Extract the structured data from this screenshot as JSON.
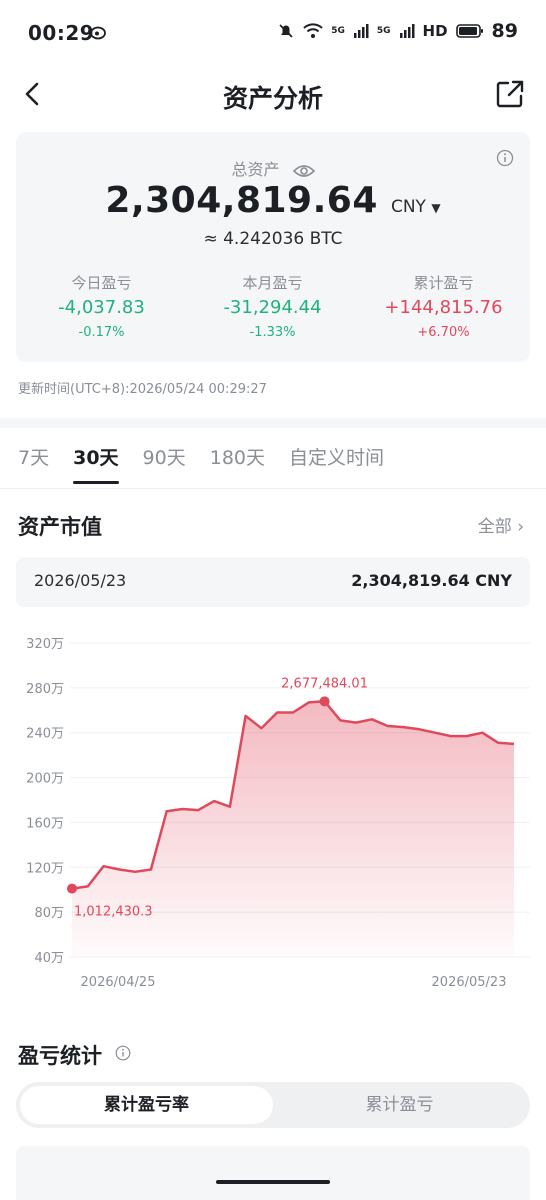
{
  "status_bar": {
    "time": "00:29",
    "signal1": "5G",
    "signal2": "5G",
    "hd": "HD",
    "battery": "89"
  },
  "header": {
    "title": "资产分析"
  },
  "summary": {
    "total_label": "总资产",
    "total_amount": "2,304,819.64",
    "currency": "CNY",
    "btc_equiv": "≈ 4.242036 BTC",
    "today": {
      "label": "今日盈亏",
      "value": "-4,037.83",
      "pct": "-0.17%"
    },
    "month": {
      "label": "本月盈亏",
      "value": "-31,294.44",
      "pct": "-1.33%"
    },
    "cumulative": {
      "label": "累计盈亏",
      "value": "+144,815.76",
      "pct": "+6.70%"
    },
    "update_time": "更新时间(UTC+8):2026/05/24 00:29:27"
  },
  "tabs": [
    {
      "label": "7天",
      "active": false
    },
    {
      "label": "30天",
      "active": true
    },
    {
      "label": "90天",
      "active": false
    },
    {
      "label": "180天",
      "active": false
    },
    {
      "label": "自定义时间",
      "active": false
    }
  ],
  "market_value": {
    "title": "资产市值",
    "more": "全部 ›",
    "selected_date": "2026/05/23",
    "selected_value": "2,304,819.64 CNY"
  },
  "pnl_stats": {
    "title": "盈亏统计",
    "seg_active": "累计盈亏率",
    "seg_inactive": "累计盈亏"
  },
  "colors": {
    "green": "#20b37b",
    "red": "#e0485c",
    "muted": "#8a8f96"
  },
  "chart_data": {
    "type": "area",
    "ylim": [
      40,
      320
    ],
    "y_ticks": [
      40,
      80,
      120,
      160,
      200,
      240,
      280,
      320
    ],
    "y_tick_labels": [
      "40万",
      "80万",
      "120万",
      "160万",
      "200万",
      "240万",
      "280万",
      "320万"
    ],
    "x_tick_labels": [
      "2026/04/25",
      "2026/05/23"
    ],
    "values": [
      101,
      103,
      121,
      118,
      116,
      118,
      170,
      172,
      171,
      179,
      174,
      255,
      244,
      258,
      258,
      267,
      268,
      251,
      249,
      252,
      246,
      245,
      243,
      240,
      237,
      237,
      240,
      231,
      230
    ],
    "min_label": "1,012,430.3",
    "max_label": "2,677,484.01",
    "min_index": 0,
    "max_index": 16
  }
}
